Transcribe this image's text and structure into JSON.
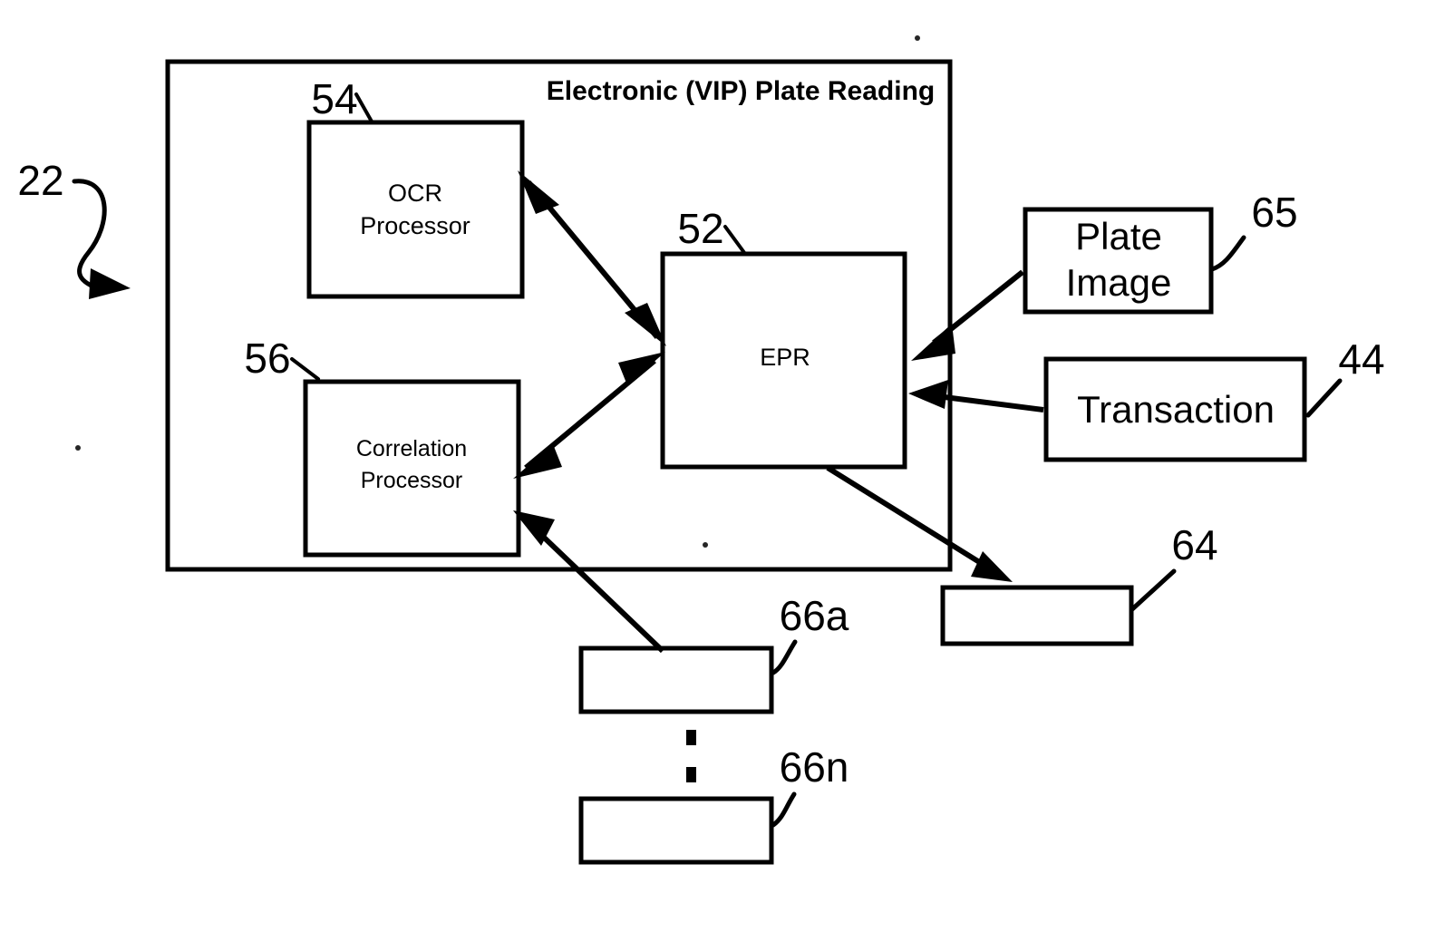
{
  "figure": {
    "type": "patent-block-diagram",
    "background_color": "#ffffff",
    "line_color": "#000000"
  },
  "container": {
    "ref": "22",
    "title": "Electronic (VIP) Plate Reading"
  },
  "blocks": [
    {
      "id": "ocr",
      "ref": "54",
      "line1": "OCR",
      "line2": "Processor"
    },
    {
      "id": "correlation",
      "ref": "56",
      "line1": "Correlation",
      "line2": "Processor"
    },
    {
      "id": "epr",
      "ref": "52",
      "line1": "EPR",
      "line2": ""
    },
    {
      "id": "plate_image",
      "ref": "65",
      "line1": "Plate",
      "line2": "Image"
    },
    {
      "id": "transaction",
      "ref": "44",
      "line1": "Transaction",
      "line2": ""
    },
    {
      "id": "output_64",
      "ref": "64",
      "line1": "",
      "line2": ""
    },
    {
      "id": "source_66a",
      "ref": "66a",
      "line1": "",
      "line2": ""
    },
    {
      "id": "source_66n",
      "ref": "66n",
      "line1": "",
      "line2": ""
    }
  ],
  "refs": {
    "container": "22",
    "epr": "52",
    "ocr": "54",
    "correlation": "56",
    "output": "64",
    "plate_image": "65",
    "source_first": "66a",
    "source_last": "66n",
    "transaction": "44"
  },
  "labels": {
    "title": "Electronic (VIP) Plate Reading",
    "ocr_line1": "OCR",
    "ocr_line2": "Processor",
    "corr_line1": "Correlation",
    "corr_line2": "Processor",
    "epr": "EPR",
    "plate_line1": "Plate",
    "plate_line2": "Image",
    "transaction": "Transaction"
  },
  "connections": [
    {
      "from": "ocr",
      "to": "epr",
      "style": "double-arrow"
    },
    {
      "from": "correlation",
      "to": "epr",
      "style": "double-arrow"
    },
    {
      "from": "plate_image",
      "to": "epr",
      "style": "single-arrow"
    },
    {
      "from": "transaction",
      "to": "epr",
      "style": "single-arrow"
    },
    {
      "from": "epr",
      "to": "output_64",
      "style": "single-arrow"
    },
    {
      "from": "source_66a",
      "to": "correlation",
      "style": "single-arrow"
    }
  ],
  "ellipsis": {
    "between": [
      "source_66a",
      "source_66n"
    ],
    "marks": 2
  }
}
